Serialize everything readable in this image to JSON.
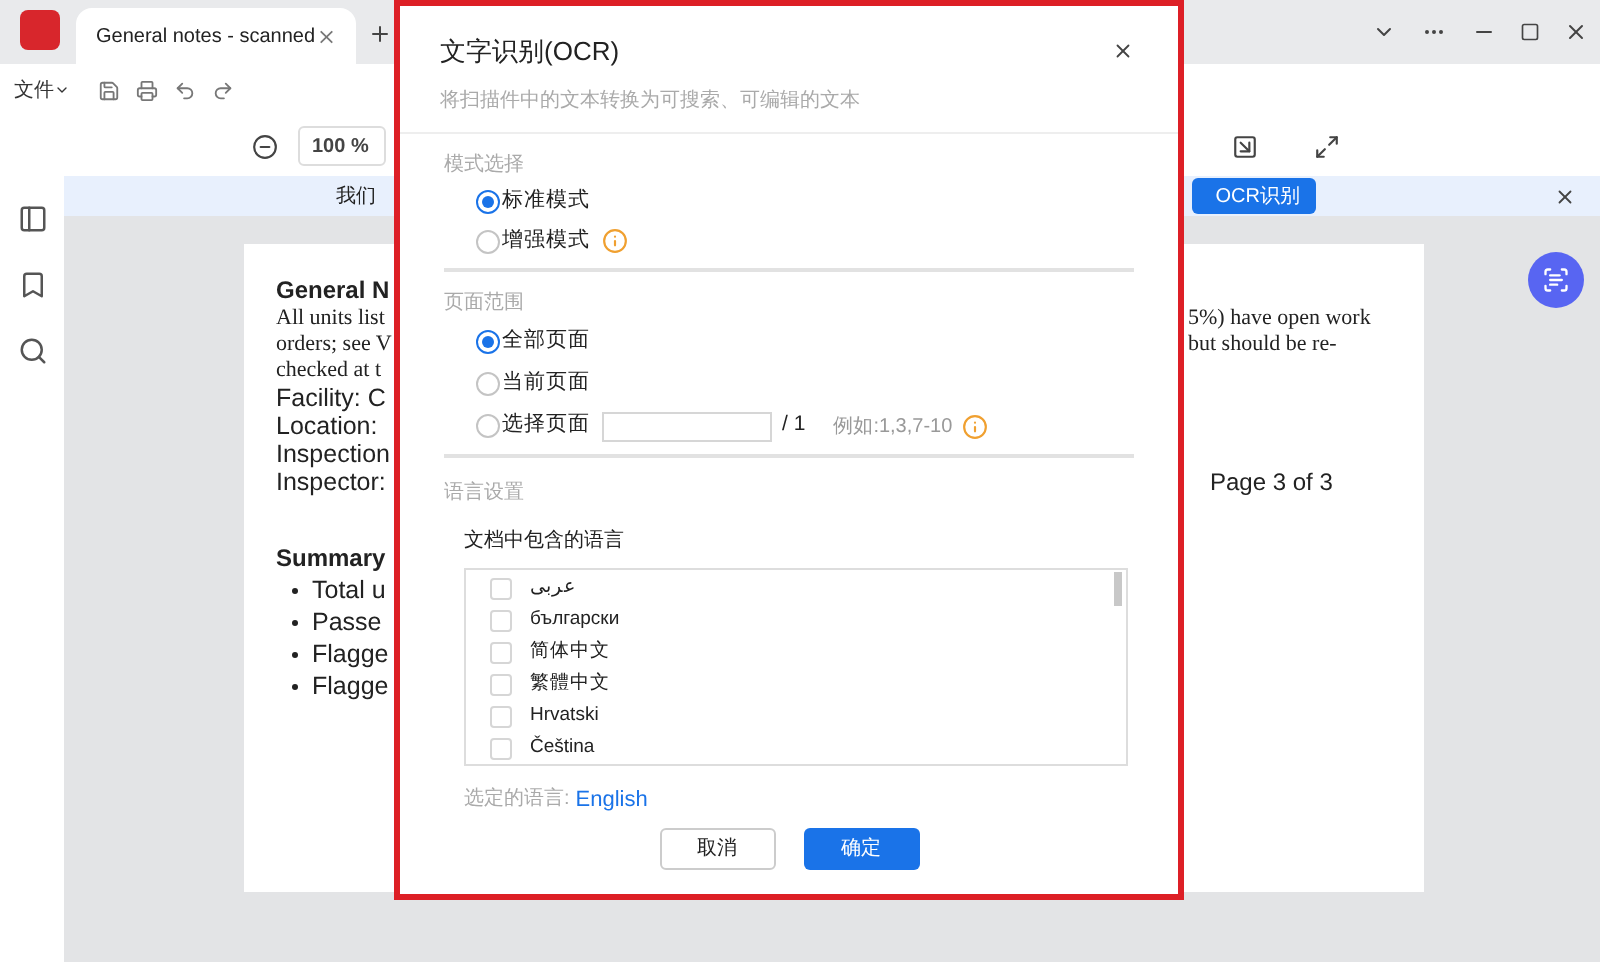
{
  "tab": {
    "title": "General notes - scanned"
  },
  "menu": {
    "file": "文件"
  },
  "zoom": {
    "value": "100 %"
  },
  "banner": {
    "text": "我们",
    "button": "OCR识别"
  },
  "document": {
    "rows": [
      {
        "kind": "heading",
        "left": "General N"
      },
      {
        "kind": "serif",
        "left": "All units list",
        "right": "5%) have open work"
      },
      {
        "kind": "serif",
        "left": "orders; see V",
        "right": "but should be re-"
      },
      {
        "kind": "serif",
        "left": "checked at t"
      },
      {
        "kind": "field",
        "left": "Facility: C"
      },
      {
        "kind": "field",
        "left": "Location:"
      },
      {
        "kind": "field",
        "left": "Inspection"
      },
      {
        "kind": "field",
        "left": "Inspector:",
        "right": "Page 3 of 3"
      },
      {
        "kind": "gap"
      },
      {
        "kind": "heading",
        "left": "Summary"
      },
      {
        "kind": "bullet",
        "left": "Total u"
      },
      {
        "kind": "bullet",
        "left": "Passe"
      },
      {
        "kind": "bullet",
        "left": "Flagge"
      },
      {
        "kind": "bullet",
        "left": "Flagge"
      }
    ]
  },
  "dialog": {
    "title": "文字识别(OCR)",
    "subtitle": "将扫描件中的文本转换为可搜索、可编辑的文本",
    "mode": {
      "label": "模式选择",
      "options": [
        {
          "label": "标准模式",
          "selected": true,
          "info": false
        },
        {
          "label": "增强模式",
          "selected": false,
          "info": true
        }
      ]
    },
    "page_range": {
      "label": "页面范围",
      "options": [
        {
          "label": "全部页面",
          "selected": true,
          "kind": "plain"
        },
        {
          "label": "当前页面",
          "selected": false,
          "kind": "plain"
        },
        {
          "label": "选择页面",
          "selected": false,
          "kind": "range"
        }
      ],
      "total": "/ 1",
      "hint": "例如:1,3,7-10"
    },
    "language": {
      "label": "语言设置",
      "list_label": "文档中包含的语言",
      "languages": [
        {
          "label": "عربى",
          "checked": false
        },
        {
          "label": "български",
          "checked": false
        },
        {
          "label": "简体中文",
          "checked": false
        },
        {
          "label": "繁體中文",
          "checked": false
        },
        {
          "label": "Hrvatski",
          "checked": false
        },
        {
          "label": "Čeština",
          "checked": false
        }
      ],
      "selected_label": "选定的语言:",
      "selected_value": "English"
    },
    "buttons": {
      "cancel": "取消",
      "ok": "确定"
    }
  }
}
